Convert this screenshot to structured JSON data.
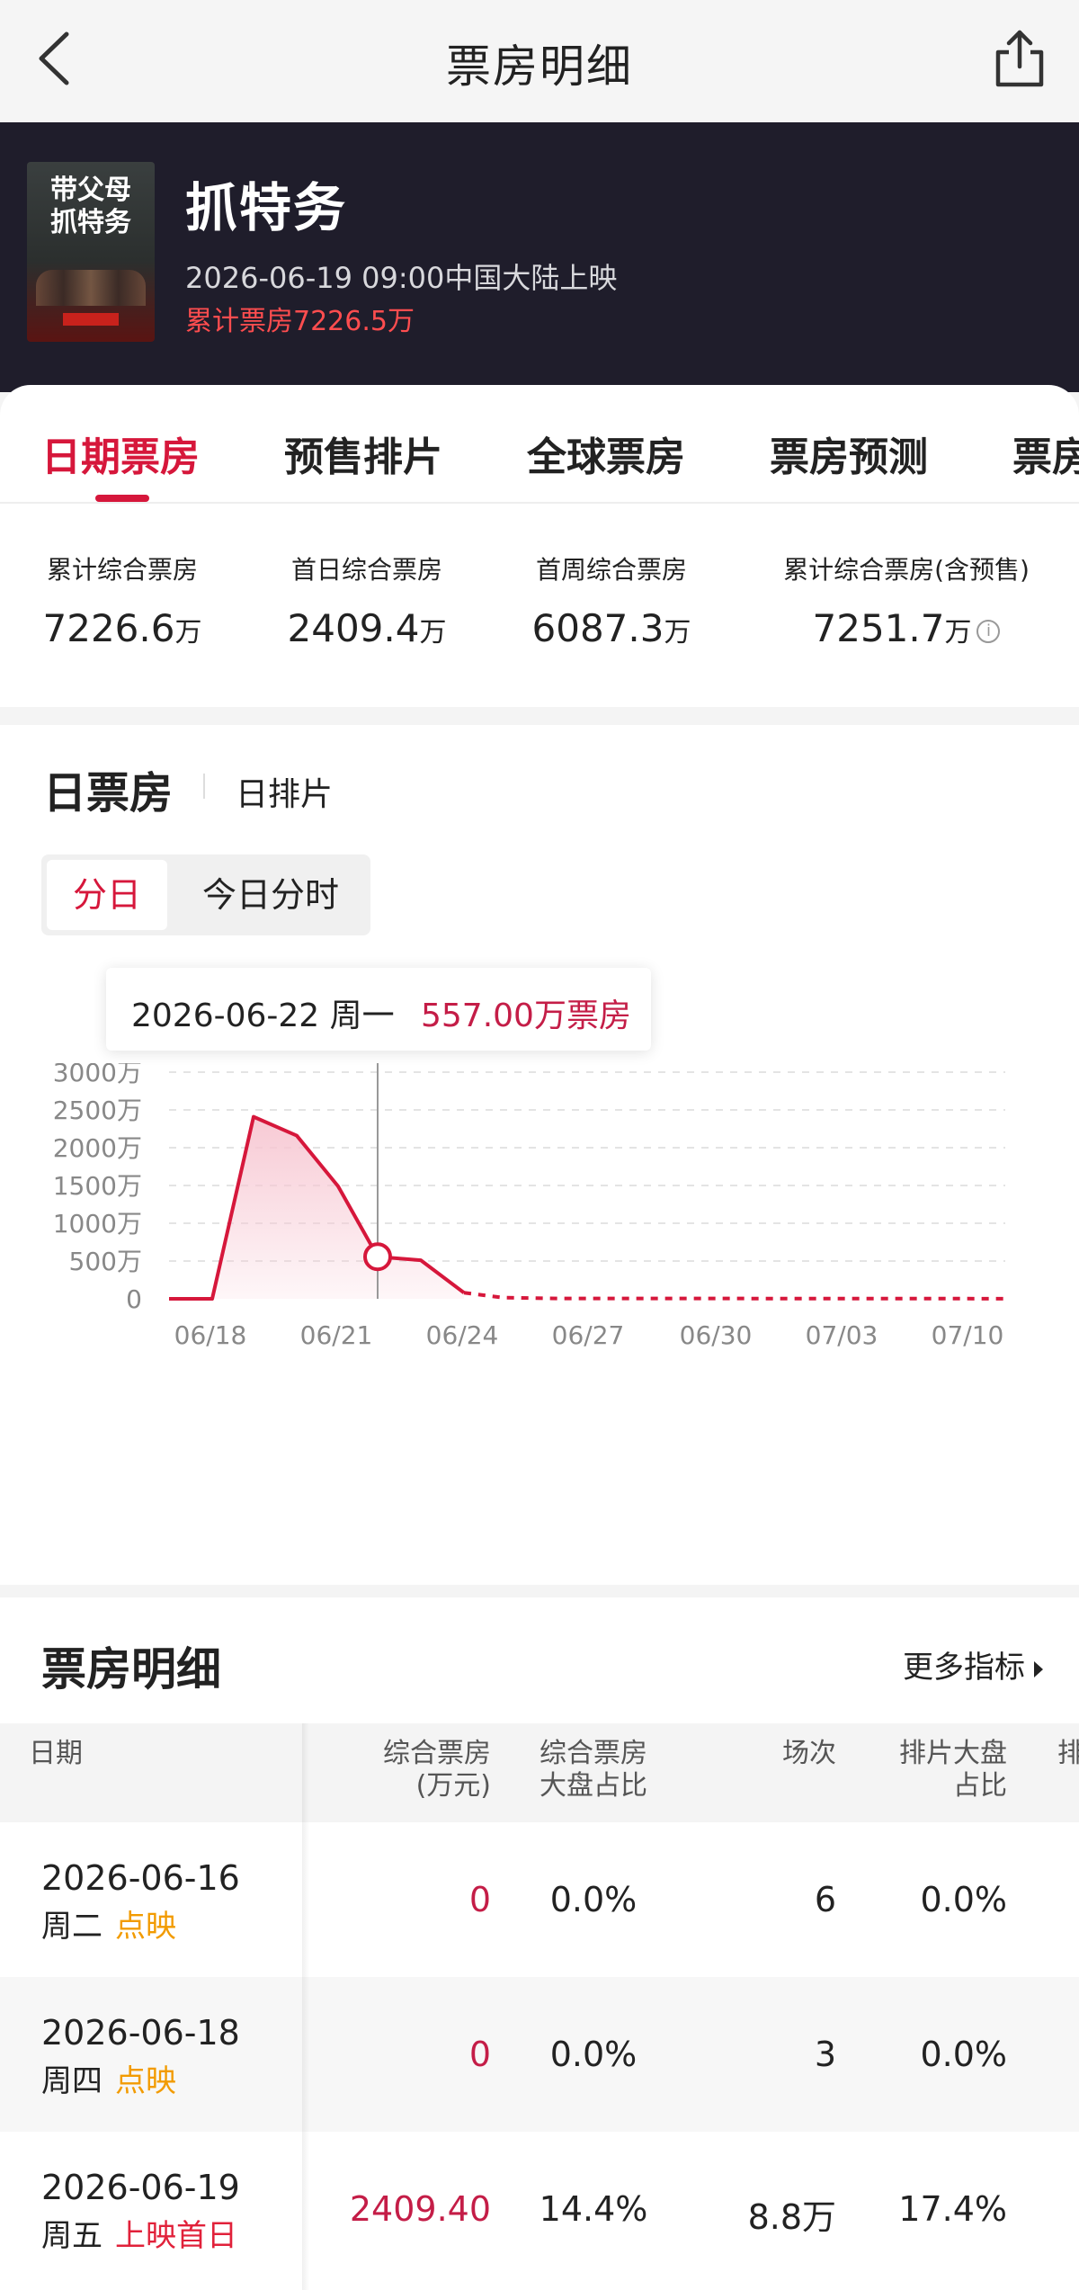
{
  "nav": {
    "title": "票房明细",
    "back_icon": "chevron-left-icon",
    "share_icon": "share-icon"
  },
  "movie": {
    "poster_text": "带父母\n抓特务",
    "name": "抓特务",
    "release": "2026-06-19 09:00中国大陆上映",
    "cumulative": "累计票房7226.5万"
  },
  "tabs": [
    "日期票房",
    "预售排片",
    "全球票房",
    "票房预测",
    "票房"
  ],
  "stats": [
    {
      "label": "累计综合票房",
      "value": "7226.6",
      "unit": "万"
    },
    {
      "label": "首日综合票房",
      "value": "2409.4",
      "unit": "万"
    },
    {
      "label": "首周综合票房",
      "value": "6087.3",
      "unit": "万"
    },
    {
      "label": "累计综合票房(含预售)",
      "value": "7251.7",
      "unit": "万"
    }
  ],
  "chart_section": {
    "title": "日票房",
    "subtitle": "日排片",
    "segment": {
      "active": "分日",
      "inactive": "今日分时"
    },
    "tooltip": {
      "date": "2026-06-22 周一",
      "value": "557.00万票房"
    }
  },
  "chart_data": {
    "type": "line",
    "y_tick_labels": [
      "3000万",
      "2500万",
      "2000万",
      "1500万",
      "1000万",
      "500万",
      "0"
    ],
    "ylim": [
      0,
      3000
    ],
    "x_tick_labels": [
      "06/18",
      "06/21",
      "06/24",
      "06/27",
      "06/30",
      "07/03",
      "07/10"
    ],
    "series": [
      {
        "actual": [
          {
            "x": "06/17",
            "y": 0
          },
          {
            "x": "06/18",
            "y": 0
          },
          {
            "x": "06/19",
            "y": 2409.4
          },
          {
            "x": "06/20",
            "y": 2160
          },
          {
            "x": "06/21",
            "y": 1490
          },
          {
            "x": "06/22",
            "y": 557
          },
          {
            "x": "06/23",
            "y": 510
          },
          {
            "x": "06/24",
            "y": 80
          }
        ],
        "forecast": [
          {
            "x": "06/24",
            "y": 80
          },
          {
            "x": "06/25",
            "y": 15
          },
          {
            "x": "06/27",
            "y": 5
          },
          {
            "x": "07/10",
            "y": 2
          }
        ]
      }
    ],
    "highlight": {
      "x": "06/22",
      "y": 557
    },
    "grid": true,
    "colors": {
      "line": "#d6173b",
      "fill": "#f7c7d2"
    }
  },
  "detail": {
    "title": "票房明细",
    "more": "更多指标",
    "headers": [
      "日期",
      "综合票房\n(万元)",
      "综合票房\n大盘占比",
      "场次",
      "排片大盘\n占比",
      "排"
    ],
    "rows": [
      {
        "date": "2026-06-16",
        "weekday": "周二",
        "tag": "点映",
        "tag_color": "orange",
        "box": "0",
        "box_share": "0.0%",
        "shows": "6",
        "show_share": "0.0%"
      },
      {
        "date": "2026-06-18",
        "weekday": "周四",
        "tag": "点映",
        "tag_color": "orange",
        "box": "0",
        "box_share": "0.0%",
        "shows": "3",
        "show_share": "0.0%"
      },
      {
        "date": "2026-06-19",
        "weekday": "周五",
        "tag": "上映首日",
        "tag_color": "red",
        "box": "2409.40",
        "box_share": "14.4%",
        "shows": "8.8万",
        "show_share": "17.4%"
      }
    ]
  }
}
